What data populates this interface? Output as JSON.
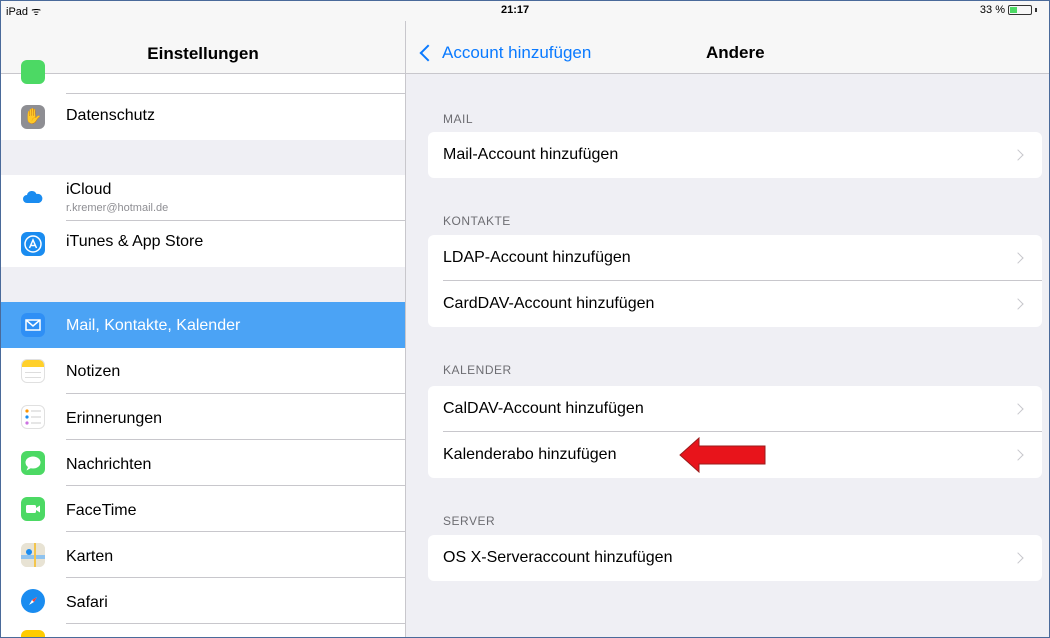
{
  "status_bar": {
    "device": "iPad ᯤ",
    "time": "21:17",
    "battery": "33 %",
    "battery_level": 0.33
  },
  "left": {
    "title": "Einstellungen",
    "items": [
      {
        "label": "Datenschutz",
        "icon": "hand-icon",
        "color": "#8e8e93"
      },
      {
        "label": "iCloud",
        "sublabel": "r.kremer@hotmail.de",
        "icon": "cloud-icon",
        "color": "#ffffff"
      },
      {
        "label": "iTunes & App Store",
        "icon": "app-store-icon",
        "color": "#1a8cf0"
      },
      {
        "label": "Mail, Kontakte, Kalender",
        "icon": "mail-icon",
        "color": "#2f8ff5",
        "selected": true
      },
      {
        "label": "Notizen",
        "icon": "notes-icon",
        "color": "#ffd02b"
      },
      {
        "label": "Erinnerungen",
        "icon": "reminders-icon",
        "color": "#ffffff"
      },
      {
        "label": "Nachrichten",
        "icon": "messages-icon",
        "color": "#4cd964"
      },
      {
        "label": "FaceTime",
        "icon": "facetime-icon",
        "color": "#4cd964"
      },
      {
        "label": "Karten",
        "icon": "maps-icon",
        "color": "#e8e3d4"
      },
      {
        "label": "Safari",
        "icon": "safari-icon",
        "color": "#1a8cf0"
      }
    ]
  },
  "right": {
    "back_label": "Account hinzufügen",
    "title": "Andere",
    "sections": [
      {
        "header": "MAIL",
        "rows": [
          "Mail-Account hinzufügen"
        ]
      },
      {
        "header": "KONTAKTE",
        "rows": [
          "LDAP-Account hinzufügen",
          "CardDAV-Account hinzufügen"
        ]
      },
      {
        "header": "KALENDER",
        "rows": [
          "CalDAV-Account hinzufügen",
          "Kalenderabo hinzufügen"
        ]
      },
      {
        "header": "SERVER",
        "rows": [
          "OS X-Serveraccount hinzufügen"
        ]
      }
    ]
  },
  "annotation": {
    "arrow_color": "#e8141b"
  }
}
